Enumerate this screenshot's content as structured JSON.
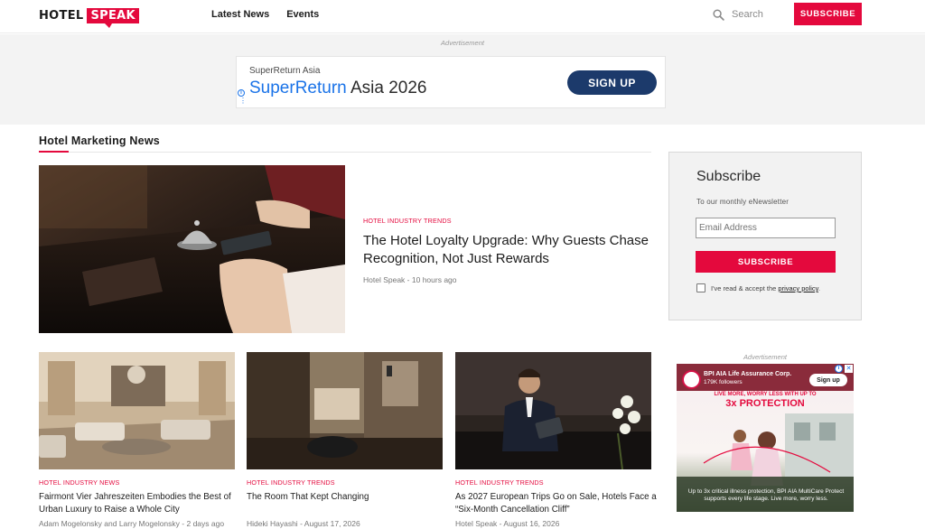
{
  "header": {
    "logo": {
      "word1": "HOTEL",
      "word2": "SPEAK"
    },
    "nav": [
      "Latest News",
      "Events"
    ],
    "search_placeholder": "Search",
    "subscribe_label": "SUBSCRIBE",
    "accent_color": "#e4093d"
  },
  "top_ad": {
    "label": "Advertisement",
    "advertiser": "SuperReturn Asia",
    "headline_part1": "SuperReturn",
    "headline_part2": " Asia 2026",
    "cta": "SIGN UP"
  },
  "section": {
    "title": "Hotel Marketing News"
  },
  "featured": {
    "kicker": "HOTEL INDUSTRY TRENDS",
    "title": "The Hotel Loyalty Upgrade: Why Guests Chase Recognition, Not Just Rewards",
    "author": "Hotel Speak",
    "time": "10 hours ago",
    "image": "hotel-reception-bell"
  },
  "cards": [
    {
      "kicker": "HOTEL INDUSTRY NEWS",
      "title": "Fairmont Vier Jahreszeiten Embodies the Best of Urban Luxury to Raise a Whole City",
      "author": "Adam Mogelonsky and Larry Mogelonsky",
      "time": "2 days ago",
      "image": "hotel-lobby-lounge"
    },
    {
      "kicker": "HOTEL INDUSTRY TRENDS",
      "title": "The Room That Kept Changing",
      "author": "Hideki Hayashi",
      "time": "August 17, 2026",
      "image": "hotel-room-door"
    },
    {
      "kicker": "HOTEL INDUSTRY TRENDS",
      "title": "As 2027 European Trips Go on Sale, Hotels Face a “Six-Month Cancellation Cliff”",
      "author": "Hotel Speak",
      "time": "August 16, 2026",
      "image": "businessman-tablet"
    }
  ],
  "subscribe_box": {
    "title": "Subscribe",
    "description": "To our monthly eNewsletter",
    "email_placeholder": "Email Address",
    "button": "SUBSCRIBE",
    "consent_text": "I've read & accept the ",
    "consent_link": "privacy policy",
    "consent_end": "."
  },
  "side_ad": {
    "label": "Advertisement",
    "advertiser": "BPI AIA Life Assurance Corp.",
    "followers": "179K followers",
    "cta": "Sign up",
    "tagline": "LIVE MORE, WORRY LESS WITH UP TO",
    "headline": "3x PROTECTION",
    "footer": "Up to 3x critical illness protection, BPI AIA MultiCare Protect supports every life stage. Live more, worry less."
  }
}
